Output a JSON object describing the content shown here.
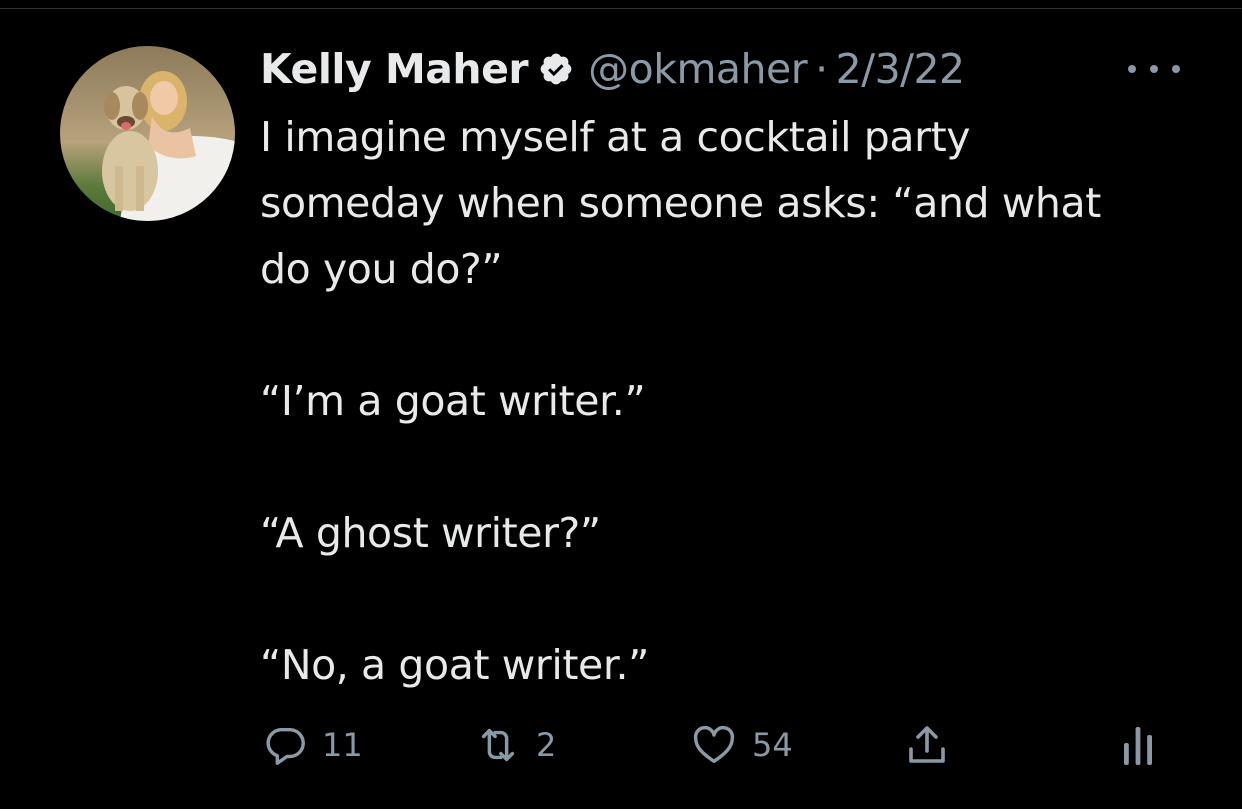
{
  "tweet": {
    "author_name": "Kelly Maher",
    "handle": "@okmaher",
    "separator": "·",
    "date": "2/3/22",
    "text_paragraphs": [
      "I imagine myself at a cocktail party someday when someone asks: “and what do you do?”",
      "“I’m a goat writer.”",
      "“A ghost writer?”",
      "“No, a goat writer.”"
    ]
  },
  "actions": {
    "reply_count": "11",
    "retweet_count": "2",
    "like_count": "54"
  },
  "icons": {
    "verified": "verified-badge-icon",
    "more": "more-horizontal-icon",
    "reply": "reply-icon",
    "retweet": "retweet-icon",
    "like": "heart-icon",
    "share": "share-icon",
    "analytics": "analytics-icon"
  },
  "colors": {
    "background": "#000000",
    "primary_text": "#e7e9ea",
    "secondary_text": "#8b98a5"
  }
}
